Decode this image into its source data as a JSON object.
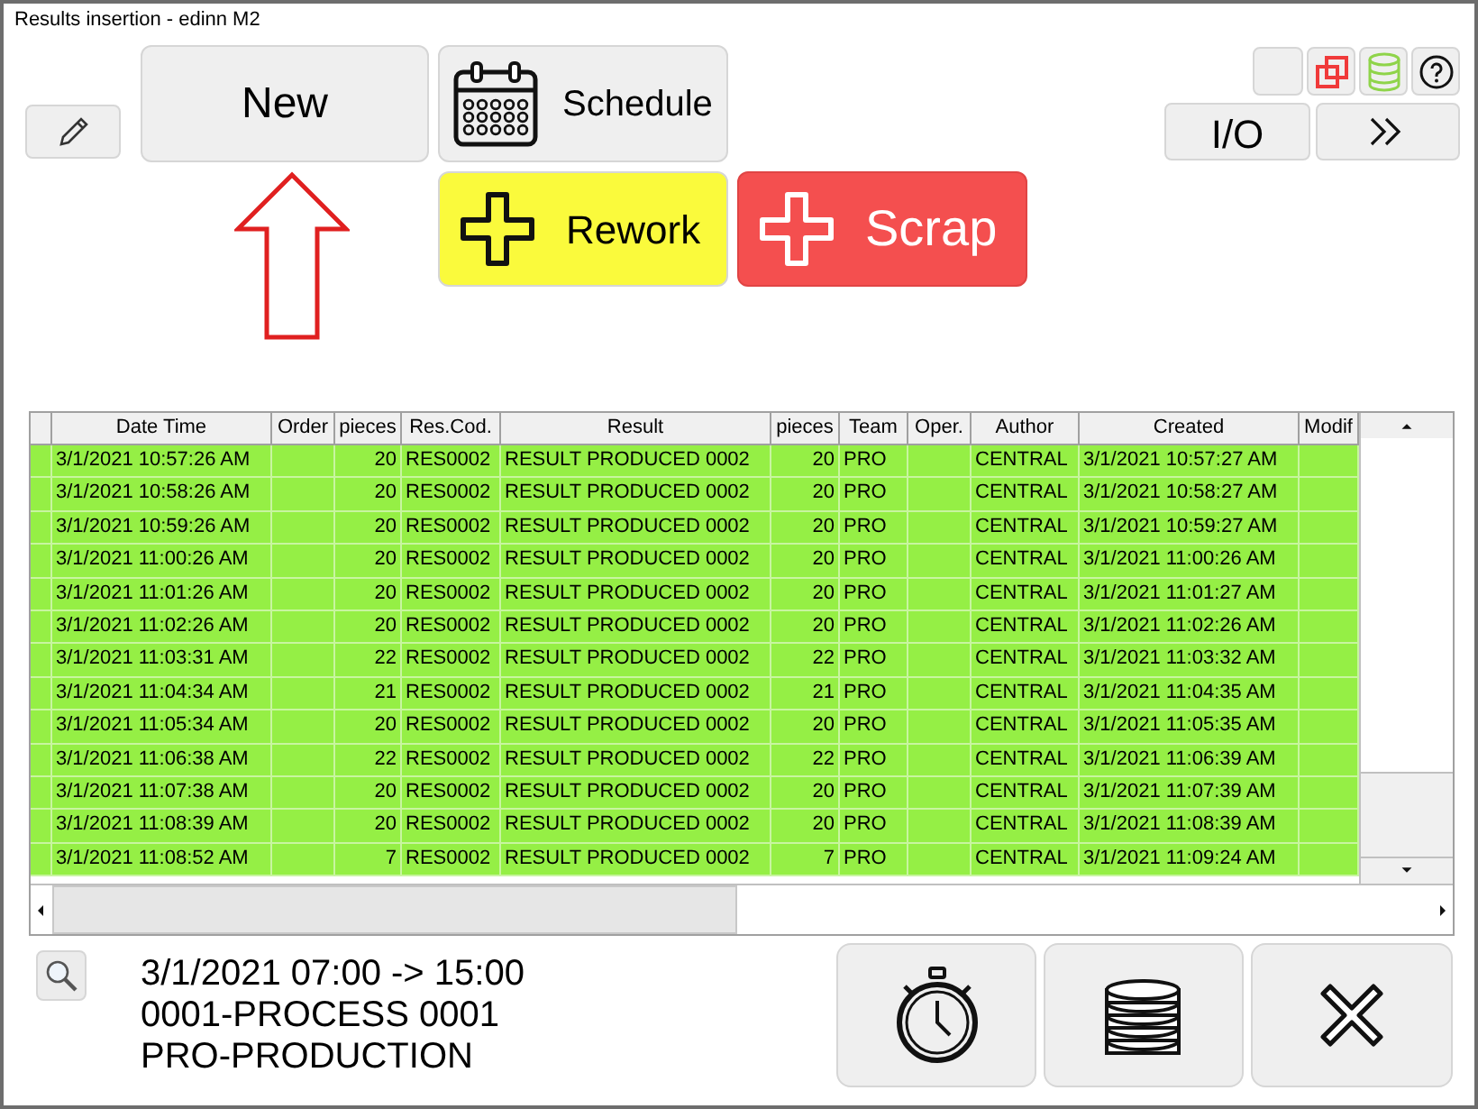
{
  "window": {
    "title": "Results insertion - edinn M2"
  },
  "toolbar": {
    "new": "New",
    "schedule": "Schedule",
    "rework": "Rework",
    "scrap": "Scrap",
    "io": "I/O"
  },
  "table": {
    "columns": [
      "Date Time",
      "Order",
      "pieces",
      "Res.Cod.",
      "Result",
      "pieces",
      "Team",
      "Oper.",
      "Author",
      "Created",
      "Modif"
    ],
    "rows": [
      {
        "date_time": "3/1/2021 10:57:26 AM",
        "pieces": "20",
        "res_cod": "RES0002",
        "result": "RESULT PRODUCED 0002",
        "pieces_2": "20",
        "team": "PRO",
        "author": "CENTRAL",
        "created": "3/1/2021 10:57:27 AM"
      },
      {
        "date_time": "3/1/2021 10:58:26 AM",
        "pieces": "20",
        "res_cod": "RES0002",
        "result": "RESULT PRODUCED 0002",
        "pieces_2": "20",
        "team": "PRO",
        "author": "CENTRAL",
        "created": "3/1/2021 10:58:27 AM"
      },
      {
        "date_time": "3/1/2021 10:59:26 AM",
        "pieces": "20",
        "res_cod": "RES0002",
        "result": "RESULT PRODUCED 0002",
        "pieces_2": "20",
        "team": "PRO",
        "author": "CENTRAL",
        "created": "3/1/2021 10:59:27 AM"
      },
      {
        "date_time": "3/1/2021 11:00:26 AM",
        "pieces": "20",
        "res_cod": "RES0002",
        "result": "RESULT PRODUCED 0002",
        "pieces_2": "20",
        "team": "PRO",
        "author": "CENTRAL",
        "created": "3/1/2021 11:00:26 AM"
      },
      {
        "date_time": "3/1/2021 11:01:26 AM",
        "pieces": "20",
        "res_cod": "RES0002",
        "result": "RESULT PRODUCED 0002",
        "pieces_2": "20",
        "team": "PRO",
        "author": "CENTRAL",
        "created": "3/1/2021 11:01:27 AM"
      },
      {
        "date_time": "3/1/2021 11:02:26 AM",
        "pieces": "20",
        "res_cod": "RES0002",
        "result": "RESULT PRODUCED 0002",
        "pieces_2": "20",
        "team": "PRO",
        "author": "CENTRAL",
        "created": "3/1/2021 11:02:26 AM"
      },
      {
        "date_time": "3/1/2021 11:03:31 AM",
        "pieces": "22",
        "res_cod": "RES0002",
        "result": "RESULT PRODUCED 0002",
        "pieces_2": "22",
        "team": "PRO",
        "author": "CENTRAL",
        "created": "3/1/2021 11:03:32 AM"
      },
      {
        "date_time": "3/1/2021 11:04:34 AM",
        "pieces": "21",
        "res_cod": "RES0002",
        "result": "RESULT PRODUCED 0002",
        "pieces_2": "21",
        "team": "PRO",
        "author": "CENTRAL",
        "created": "3/1/2021 11:04:35 AM"
      },
      {
        "date_time": "3/1/2021 11:05:34 AM",
        "pieces": "20",
        "res_cod": "RES0002",
        "result": "RESULT PRODUCED 0002",
        "pieces_2": "20",
        "team": "PRO",
        "author": "CENTRAL",
        "created": "3/1/2021 11:05:35 AM"
      },
      {
        "date_time": "3/1/2021 11:06:38 AM",
        "pieces": "22",
        "res_cod": "RES0002",
        "result": "RESULT PRODUCED 0002",
        "pieces_2": "22",
        "team": "PRO",
        "author": "CENTRAL",
        "created": "3/1/2021 11:06:39 AM"
      },
      {
        "date_time": "3/1/2021 11:07:38 AM",
        "pieces": "20",
        "res_cod": "RES0002",
        "result": "RESULT PRODUCED 0002",
        "pieces_2": "20",
        "team": "PRO",
        "author": "CENTRAL",
        "created": "3/1/2021 11:07:39 AM"
      },
      {
        "date_time": "3/1/2021 11:08:39 AM",
        "pieces": "20",
        "res_cod": "RES0002",
        "result": "RESULT PRODUCED 0002",
        "pieces_2": "20",
        "team": "PRO",
        "author": "CENTRAL",
        "created": "3/1/2021 11:08:39 AM"
      },
      {
        "date_time": "3/1/2021 11:08:52 AM",
        "pieces": "7",
        "res_cod": "RES0002",
        "result": "RESULT PRODUCED 0002",
        "pieces_2": "7",
        "team": "PRO",
        "author": "CENTRAL",
        "created": "3/1/2021 11:09:24 AM"
      }
    ]
  },
  "info": {
    "shift": "3/1/2021 07:00 -> 15:00",
    "process": "0001-PROCESS 0001",
    "team": "PRO-PRODUCTION"
  }
}
